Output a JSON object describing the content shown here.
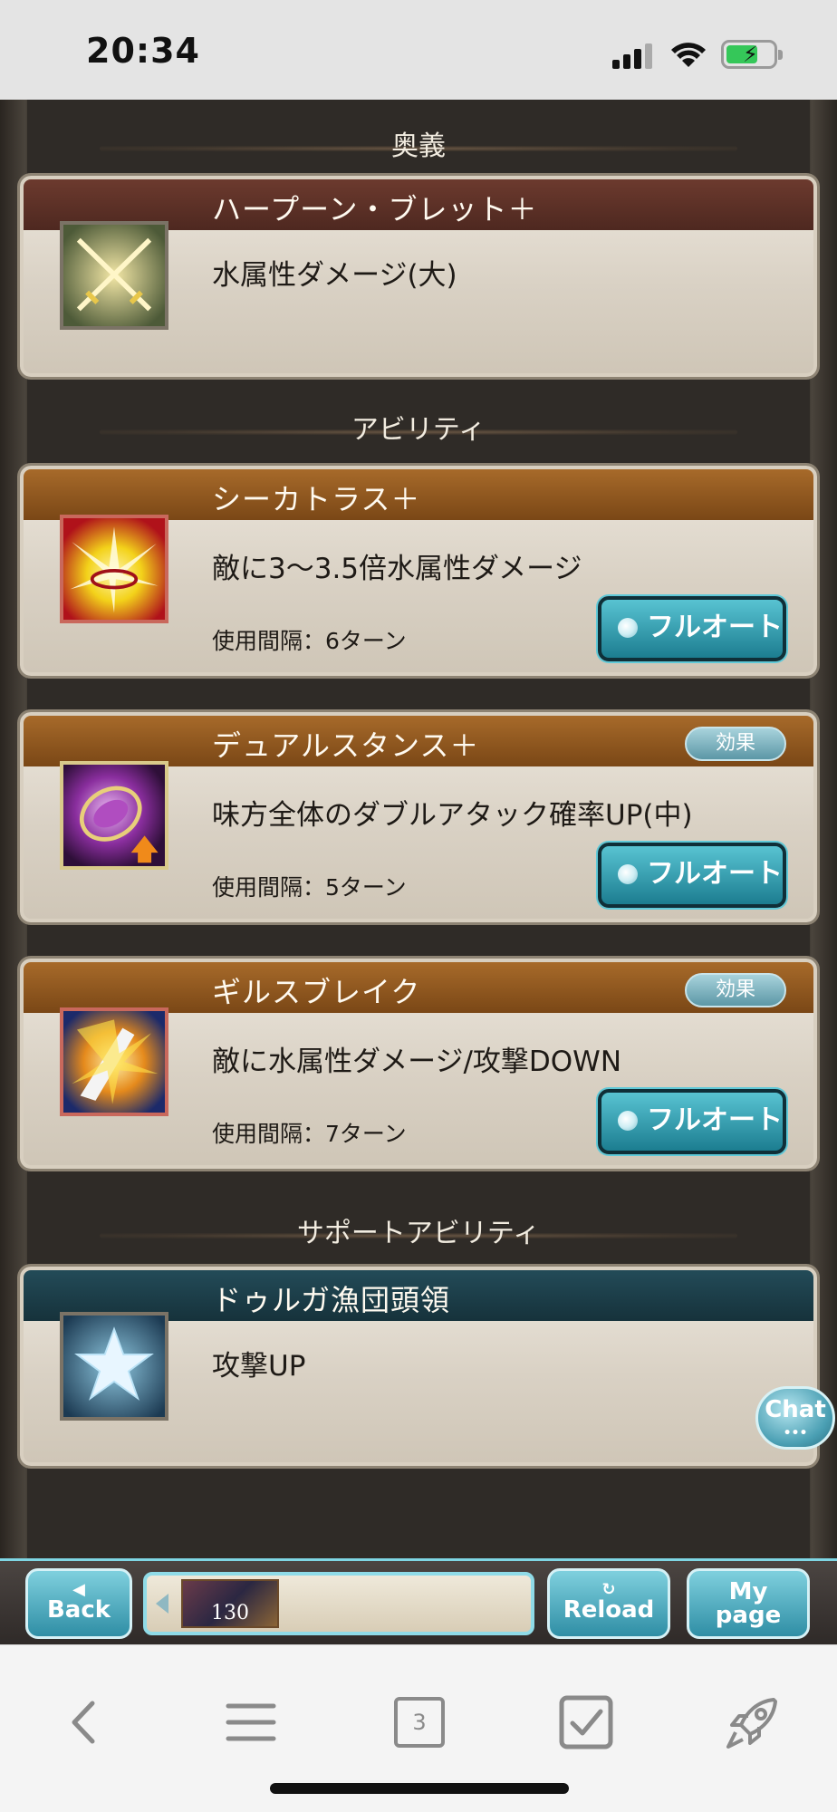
{
  "status_bar": {
    "time": "20:34"
  },
  "sections": {
    "ougi": "奥義",
    "ability": "アビリティ",
    "support": "サポートアビリティ"
  },
  "ougi_card": {
    "name": "ハープーン・ブレット＋",
    "description": "水属性ダメージ(大)"
  },
  "abilities": [
    {
      "name": "シーカトラス＋",
      "description": "敵に3〜3.5倍水属性ダメージ",
      "interval": "使用間隔：6ターン",
      "button": "フルオート"
    },
    {
      "name": "デュアルスタンス＋",
      "badge": "効果",
      "description": "味方全体のダブルアタック確率UP(中)",
      "interval": "使用間隔：5ターン",
      "button": "フルオート"
    },
    {
      "name": "ギルスブレイク",
      "badge": "効果",
      "description": "敵に水属性ダメージ/攻撃DOWN",
      "interval": "使用間隔：7ターン",
      "button": "フルオート"
    }
  ],
  "support_card": {
    "name": "ドゥルガ漁団頭領",
    "description": "攻撃UP"
  },
  "chat_button": "Chat",
  "game_bar": {
    "back": [
      "Back"
    ],
    "reload": "Reload",
    "mypage": [
      "My",
      "page"
    ],
    "thumbnail_number": "130"
  },
  "browser_toolbar": {
    "tab_count": "3"
  },
  "colors": {
    "accent_teal": "#2f8ea5",
    "header_brown": "#4e2820",
    "header_orange": "#a76a2a",
    "header_teal": "#234b58"
  }
}
